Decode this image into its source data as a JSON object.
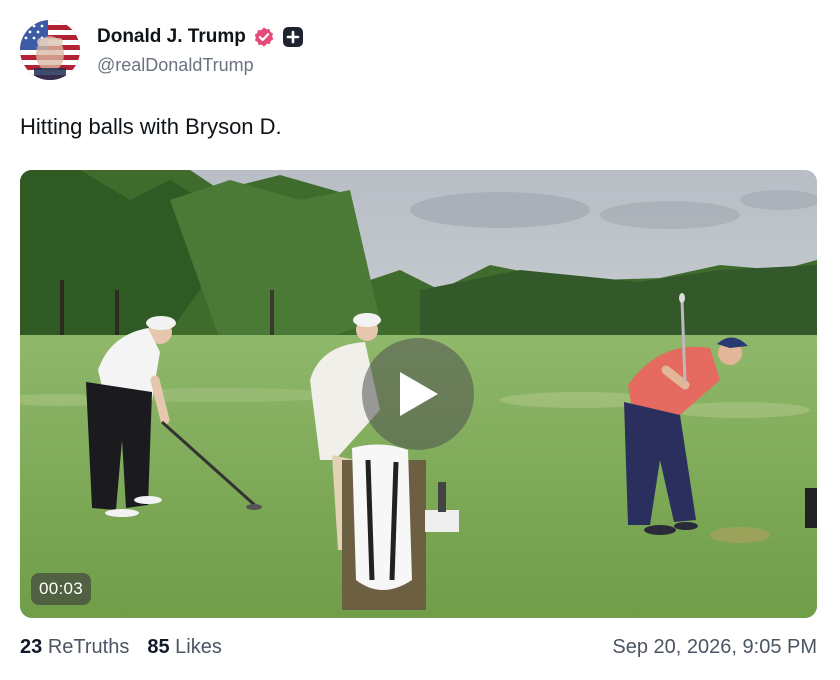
{
  "author": {
    "display_name": "Donald J. Trump",
    "handle": "@realDonaldTrump",
    "avatar_icon": "flag-portrait-avatar",
    "verified_icon": "verified-badge-icon",
    "verified_color": "#e64a7a",
    "extra_badge_icon": "plus-badge-icon"
  },
  "post": {
    "text": "Hitting balls with Bryson D."
  },
  "media": {
    "type": "video",
    "duration": "00:03",
    "play_icon": "play-icon"
  },
  "stats": {
    "retruths_count": "23",
    "retruths_label": "ReTruths",
    "likes_count": "85",
    "likes_label": "Likes"
  },
  "timestamp": "Sep 20, 2026, 9:05 PM"
}
